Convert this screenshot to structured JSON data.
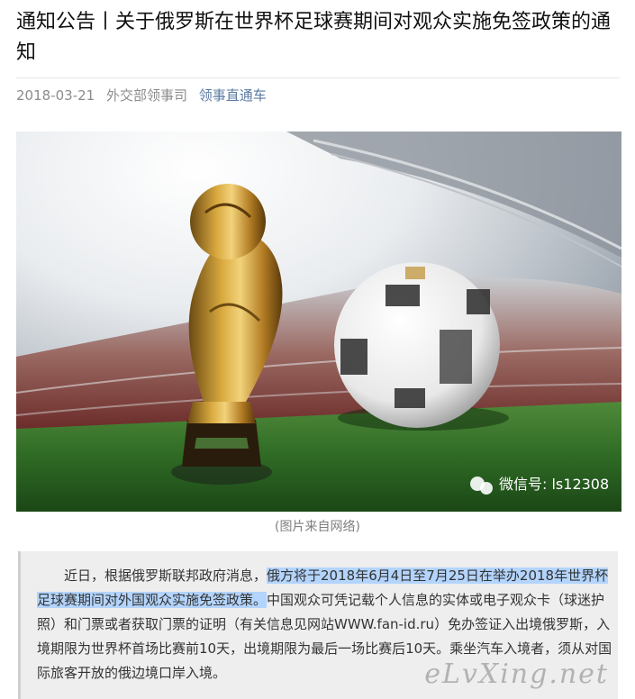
{
  "article": {
    "title": "通知公告丨关于俄罗斯在世界杯足球赛期间对观众实施免签政策的通知",
    "date": "2018-03-21",
    "source": "外交部领事司",
    "account": "领事直通车"
  },
  "image": {
    "wechat_label": "微信号: ls12308",
    "caption": "(图片来自网络)"
  },
  "body": {
    "intro": "近日，根据俄罗斯联邦政府消息，",
    "highlight": "俄方将于2018年6月4日至7月25日在举办2018年世界杯足球赛期间对外国观众实施免签政策。",
    "rest": "中国观众可凭记载个人信息的实体或电子观众卡（球迷护照）和门票或者获取门票的证明（有关信息见网站WWW.fan-id.ru）免办签证入出境俄罗斯，入境期限为世界杯首场比赛前10天，出境期限为最后一场比赛后10天。乘坐汽车入境者，须从对国际旅客开放的俄边境口岸入境。"
  },
  "watermark": "eLvXing.net",
  "colors": {
    "accent_link": "#5b7ba4",
    "highlight": "#b3d4fc",
    "quote_bg": "#eeeeee"
  }
}
